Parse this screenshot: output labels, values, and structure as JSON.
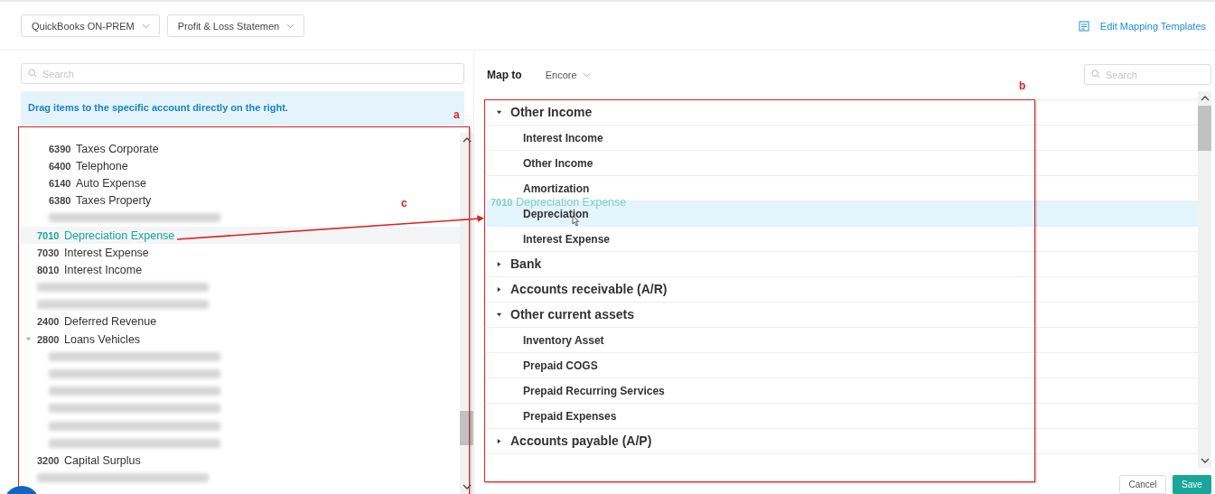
{
  "toolbar": {
    "source_dropdown": "QuickBooks ON-PREM",
    "report_dropdown": "Profit & Loss Statemen",
    "edit_link": "Edit Mapping Templates"
  },
  "left_panel": {
    "search": {
      "placeholder": "Search"
    },
    "hint": "Drag items to the specific account directly on the right.",
    "accounts_continued": [
      {
        "kind": "account",
        "code": "6390",
        "name": "Taxes Corporate",
        "selected": false
      },
      {
        "kind": "account",
        "code": "6400",
        "name": "Telephone",
        "selected": false
      },
      {
        "kind": "account",
        "code": "6140",
        "name": "Auto Expense",
        "selected": false
      },
      {
        "kind": "account",
        "code": "6380",
        "name": "Taxes Property",
        "selected": false
      },
      {
        "kind": "redacted",
        "selected": false
      }
    ],
    "accounts": [
      {
        "kind": "account",
        "code": "7010",
        "name": "Depreciation Expense",
        "selected": true
      },
      {
        "kind": "account",
        "code": "7030",
        "name": "Interest Expense",
        "selected": false
      },
      {
        "kind": "account",
        "code": "8010",
        "name": "Interest Income",
        "selected": false
      },
      {
        "kind": "redacted",
        "selected": false
      },
      {
        "kind": "redacted",
        "selected": false
      },
      {
        "kind": "account",
        "code": "2400",
        "name": "Deferred Revenue",
        "selected": false
      },
      {
        "kind": "account",
        "code": "2800",
        "name": "Loans Vehicles",
        "selected": false,
        "expanded": true,
        "children": [
          {
            "kind": "redacted",
            "selected": false
          },
          {
            "kind": "redacted",
            "selected": false
          },
          {
            "kind": "redacted",
            "selected": false
          },
          {
            "kind": "redacted",
            "selected": false
          },
          {
            "kind": "redacted",
            "selected": false
          },
          {
            "kind": "redacted",
            "selected": false
          }
        ]
      },
      {
        "kind": "account",
        "code": "3200",
        "name": "Capital Surplus",
        "selected": false
      },
      {
        "kind": "redacted",
        "selected": false
      }
    ]
  },
  "right_panel": {
    "map_to_label": "Map to",
    "target_dropdown": "Encore",
    "search": {
      "placeholder": "Search"
    },
    "groups": [
      {
        "label": "Other Income",
        "expanded": true,
        "children": [
          {
            "label": "Interest Income",
            "selected": false
          },
          {
            "label": "Other Income",
            "selected": false
          },
          {
            "label": "Amortization",
            "selected": false
          },
          {
            "label": "Depreciation",
            "selected": true
          },
          {
            "label": "Interest Expense",
            "selected": false
          }
        ]
      },
      {
        "label": "Bank",
        "expanded": false
      },
      {
        "label": "Accounts receivable (A/R)",
        "expanded": false
      },
      {
        "label": "Other current assets",
        "expanded": true,
        "children": [
          {
            "label": "Inventory Asset",
            "selected": false
          },
          {
            "label": "Prepaid COGS",
            "selected": false
          },
          {
            "label": "Prepaid Recurring Services",
            "selected": false
          },
          {
            "label": "Prepaid Expenses",
            "selected": false
          }
        ]
      },
      {
        "label": "Accounts payable (A/P)",
        "expanded": false
      }
    ]
  },
  "drag_ghost": {
    "code": "7010",
    "name": "Depreciation Expense"
  },
  "buttons": {
    "cancel": "Cancel",
    "save": "Save"
  },
  "annotations": [
    {
      "label": "a"
    },
    {
      "label": "b"
    },
    {
      "label": "c"
    }
  ]
}
